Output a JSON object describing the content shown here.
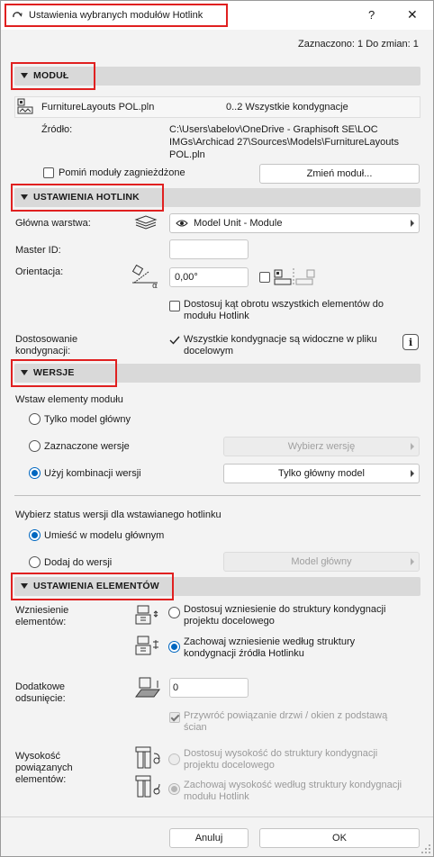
{
  "window": {
    "title": "Ustawienia wybranych modułów Hotlink",
    "help_label": "?",
    "close_label": "✕"
  },
  "header": {
    "selection_info": "Zaznaczono: 1 Do zmian: 1"
  },
  "modul": {
    "title": "MODUŁ",
    "file_name": "FurnitureLayouts POL.pln",
    "stories": "0..2 Wszystkie kondygnacje",
    "source_label": "Źródło:",
    "source_path_lines": [
      "C:\\Users\\abelov\\OneDrive - Graphisoft SE\\LOC",
      "IMGs\\Archicad 27\\Sources\\Models\\FurnitureLayouts",
      "POL.pln"
    ],
    "skip_nested_label": "Pomiń moduły zagnieżdżone",
    "change_module_button": "Zmień moduł..."
  },
  "hotlink": {
    "title": "USTAWIENIA HOTLINK",
    "main_layer_label": "Główna warstwa:",
    "main_layer_value": "Model Unit - Module",
    "master_id_label": "Master ID:",
    "master_id_value": "",
    "orientation_label": "Orientacja:",
    "orientation_value": "0,00°",
    "adjust_rotation_lines": [
      "Dostosuj kąt obrotu wszystkich elementów do",
      "modułu Hotlink"
    ],
    "story_adjust_label_lines": [
      "Dostosowanie",
      "kondygnacji:"
    ],
    "story_adjust_value_lines": [
      "Wszystkie kondygnacje są widoczne w pliku",
      "docelowym"
    ],
    "info_label": "i"
  },
  "wersje": {
    "title": "WERSJE",
    "insert_label": "Wstaw elementy modułu",
    "opt_main": "Tylko model główny",
    "opt_selected": "Zaznaczone wersje",
    "opt_combination": "Użyj kombinacji wersji",
    "choose_version_button": "Wybierz wersję",
    "main_model_only_button": "Tylko główny model",
    "status_label": "Wybierz status wersji dla wstawianego hotlinku",
    "opt_place_main": "Umieść w modelu głównym",
    "opt_add_version": "Dodaj do wersji",
    "main_model_button": "Model główny"
  },
  "elements": {
    "title": "USTAWIENIA ELEMENTÓW",
    "elevation_label_lines": [
      "Wzniesienie",
      "elementów:"
    ],
    "elev_opt1_lines": [
      "Dostosuj wzniesienie do struktury kondygnacji",
      "projektu docelowego"
    ],
    "elev_opt2_lines": [
      "Zachowaj wzniesienie według struktury",
      "kondygnacji źródła Hotlinku"
    ],
    "offset_label_lines": [
      "Dodatkowe",
      "odsunięcie:"
    ],
    "offset_value": "0",
    "restore_link_lines": [
      "Przywróć powiązanie drzwi / okien z podstawą",
      "ścian"
    ],
    "height_label_lines": [
      "Wysokość",
      "powiązanych",
      "elementów:"
    ],
    "height_opt1_lines": [
      "Dostosuj wysokość do struktury kondygnacji",
      "projektu docelowego"
    ],
    "height_opt2_lines": [
      "Zachowaj wysokość według struktury kondygnacji",
      "modułu Hotlink"
    ]
  },
  "footer": {
    "cancel_button": "Anuluj",
    "ok_button": "OK"
  },
  "colors": {
    "highlight": "#e02020",
    "accent": "#0067c0",
    "section_bg": "#d9d9d9"
  },
  "icons": [
    "hotlink-dialog-icon",
    "help-icon",
    "close-icon",
    "module-file-icon",
    "layer-stack-icon",
    "eye-icon",
    "orientation-icon",
    "mirror-icon",
    "checkmark-icon",
    "info-icon",
    "elevation-adjust-icon",
    "elevation-keep-icon",
    "offset-icon",
    "height-adjust-icon",
    "height-keep-icon",
    "resize-grip-icon"
  ]
}
